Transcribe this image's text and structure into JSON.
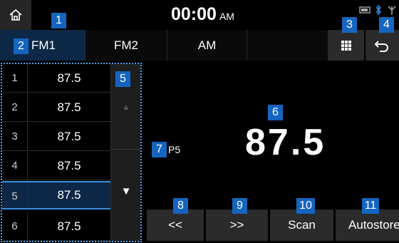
{
  "status": {
    "time": "00:00",
    "ampm": "AM"
  },
  "tabs": [
    {
      "label": "FM1",
      "active": true
    },
    {
      "label": "FM2",
      "active": false
    },
    {
      "label": "AM",
      "active": false
    },
    {
      "label": "",
      "active": false
    }
  ],
  "icons": {
    "home": "home-icon",
    "grid": "grid-icon",
    "back": "back-icon",
    "scroll_up": "scroll-up-icon",
    "scroll_down": "scroll-down-icon",
    "phone": "phone-icon",
    "bluetooth": "bluetooth-icon",
    "signal": "signal-icon"
  },
  "presets": [
    {
      "num": "1",
      "freq": "87.5"
    },
    {
      "num": "2",
      "freq": "87.5"
    },
    {
      "num": "3",
      "freq": "87.5"
    },
    {
      "num": "4",
      "freq": "87.5"
    },
    {
      "num": "5",
      "freq": "87.5",
      "selected": true
    },
    {
      "num": "6",
      "freq": "87.5"
    }
  ],
  "current": {
    "frequency": "87.5",
    "preset_tag": "P5"
  },
  "buttons": {
    "prev": "<<",
    "next": ">>",
    "scan": "Scan",
    "autostore": "Autostore"
  },
  "callouts": [
    "1",
    "2",
    "3",
    "4",
    "5",
    "6",
    "7",
    "8",
    "9",
    "10",
    "11"
  ],
  "colors": {
    "callout": "#1565c0",
    "active_tab": "#0c2846",
    "selection": "#3b8ee0"
  }
}
